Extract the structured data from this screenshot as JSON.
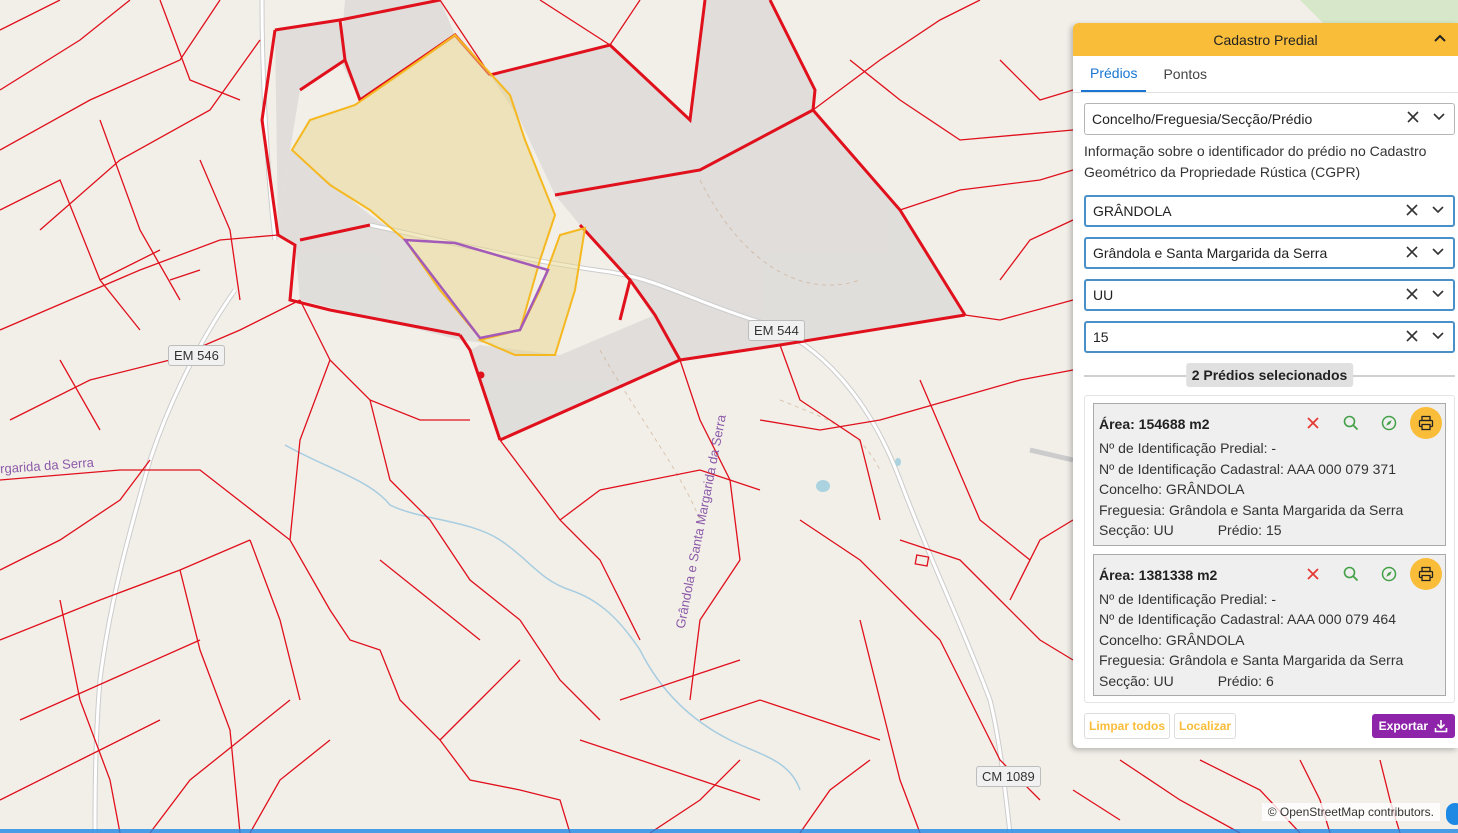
{
  "map": {
    "road_labels": [
      "EM 544",
      "EM 546",
      "CM 1089"
    ],
    "place_labels": [
      "rgarida da Serra",
      "Grândola e Santa Margarida da Serra"
    ],
    "attribution": "© OpenStreetMap contributors."
  },
  "panel": {
    "title": "Cadastro Predial",
    "collapse_icon": "chevron-up-icon",
    "tabs": [
      {
        "label": "Prédios",
        "active": true
      },
      {
        "label": "Pontos",
        "active": false
      }
    ],
    "search_type": "Concelho/Freguesia/Secção/Prédio",
    "info_text": "Informação sobre o identificador do prédio no Cadastro Geométrico da Propriedade Rústica (CGPR)",
    "concelho": "GRÂNDOLA",
    "freguesia": "Grândola e Santa Margarida da Serra",
    "seccao": "UU",
    "predio": "15",
    "selected_count": "2 Prédios selecionados",
    "results": [
      {
        "area": "Área: 154688 m2",
        "predial_id": "Nº de Identificação Predial: -",
        "cadastral_id": "Nº de Identificação Cadastral: AAA 000 079 371",
        "concelho": "Concelho: GRÂNDOLA",
        "freguesia": "Freguesia: Grândola e Santa Margarida da Serra",
        "seccao": "Secção: UU",
        "predio": "Prédio: 15"
      },
      {
        "area": "Área: 1381338 m2",
        "predial_id": "Nº de Identificação Predial: -",
        "cadastral_id": "Nº de Identificação Cadastral: AAA 000 079 464",
        "concelho": "Concelho: GRÂNDOLA",
        "freguesia": "Freguesia: Grândola e Santa Margarida da Serra",
        "seccao": "Secção: UU",
        "predio": "Prédio: 6"
      }
    ],
    "buttons": {
      "clear_all": "Limpar todos",
      "locate": "Localizar",
      "export": "Exportar"
    },
    "colors": {
      "accent": "#f9bd3a",
      "tab_active": "#1976d2",
      "export": "#8e24aa",
      "parcel_border": "#e0101c"
    }
  }
}
